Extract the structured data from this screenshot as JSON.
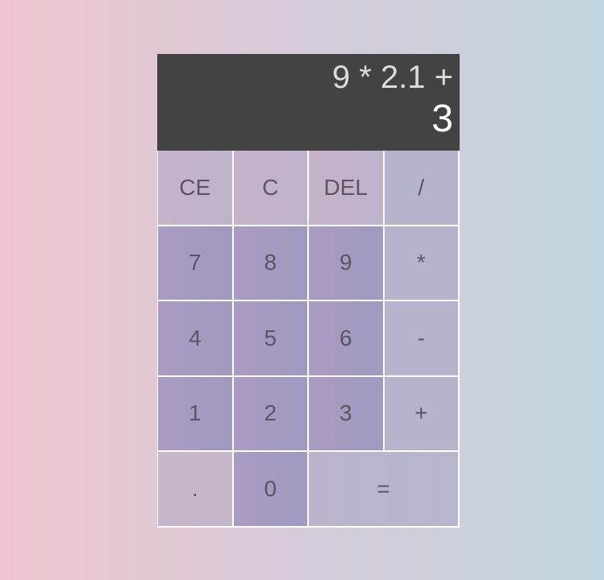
{
  "display": {
    "previous": "9 * 2.1 +",
    "current": "3"
  },
  "keys": {
    "ce": "CE",
    "clear": "C",
    "del": "DEL",
    "divide": "/",
    "seven": "7",
    "eight": "8",
    "nine": "9",
    "multiply": "*",
    "four": "4",
    "five": "5",
    "six": "6",
    "subtract": "-",
    "one": "1",
    "two": "2",
    "three": "3",
    "add": "+",
    "dot": ".",
    "zero": "0",
    "equals": "="
  },
  "colors": {
    "display_bg": "#444344",
    "key_text": "#5a5560",
    "number_key": "#a59bc1",
    "function_key": "#c3b3cb",
    "operator_key": "#b6b4cc"
  }
}
